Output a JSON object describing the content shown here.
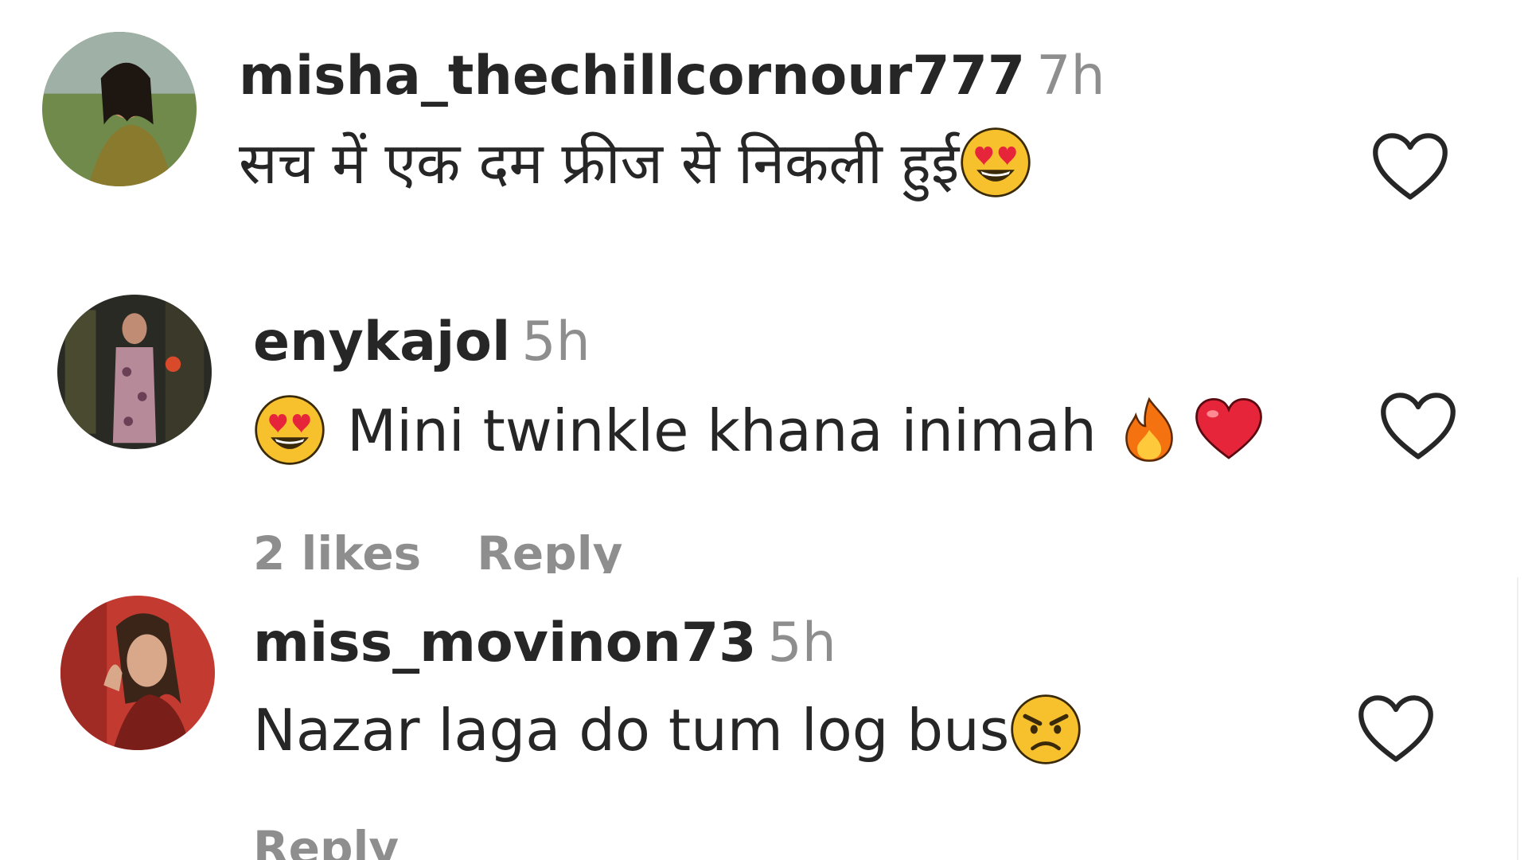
{
  "comments": [
    {
      "username": "misha_thechillcornour777",
      "time": "7h",
      "text": "सच में एक दम फ्रीज से निकली हुई",
      "emojis": [
        "heart-eyes"
      ]
    },
    {
      "username": "enykajol",
      "time": "5h",
      "text": "Mini twinkle khana inimah",
      "emojis": [
        "heart-eyes",
        "fire",
        "red-heart"
      ],
      "likes": "2 likes",
      "reply": "Reply"
    },
    {
      "username": "miss_movinon73",
      "time": "5h",
      "text": "Nazar laga do tum log bus",
      "emojis": [
        "angry-face"
      ],
      "reply": "Reply"
    }
  ],
  "colors": {
    "text": "#262626",
    "muted": "#8e8e8e",
    "heart_outline": "#262626",
    "emoji_yellow": "#f7c02d",
    "emoji_red": "#e6253a"
  }
}
